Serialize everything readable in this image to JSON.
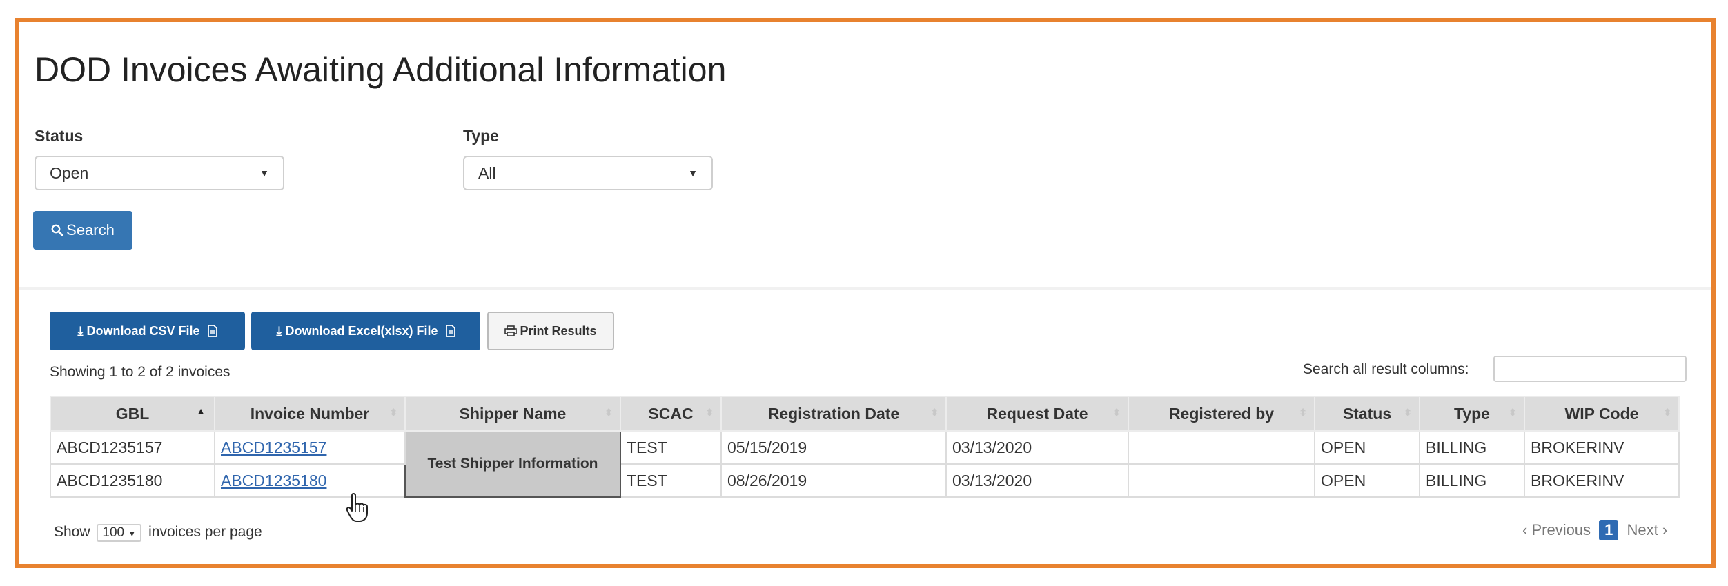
{
  "page": {
    "title": "DOD Invoices Awaiting Additional Information"
  },
  "filters": {
    "status_label": "Status",
    "status_value": "Open",
    "type_label": "Type",
    "type_value": "All",
    "caret": "▼"
  },
  "search_button": {
    "icon": "search-icon",
    "label": "Search"
  },
  "toolbar": {
    "csv_label": "Download CSV File",
    "excel_label": "Download Excel(xlsx) File",
    "print_label": "Print Results"
  },
  "results": {
    "showing": "Showing 1 to 2 of 2 invoices",
    "search_all_label": "Search all result columns:",
    "search_all_value": ""
  },
  "table": {
    "columns": [
      "GBL",
      "Invoice Number",
      "Shipper Name",
      "SCAC",
      "Registration Date",
      "Request Date",
      "Registered by",
      "Status",
      "Type",
      "WIP Code"
    ],
    "rows": [
      {
        "gbl": "ABCD1235157",
        "invoice": "ABCD1235157",
        "shipper": "Test Shipper Information",
        "scac": "TEST",
        "reg_date": "05/15/2019",
        "req_date": "03/13/2020",
        "registered_by": "",
        "status": "OPEN",
        "type": "BILLING",
        "wip": "BROKERINV"
      },
      {
        "gbl": "ABCD1235180",
        "invoice": "ABCD1235180",
        "shipper": "Test Shipper Information",
        "scac": "TEST",
        "reg_date": "08/26/2019",
        "req_date": "03/13/2020",
        "registered_by": "",
        "status": "OPEN",
        "type": "BILLING",
        "wip": "BROKERINV"
      }
    ]
  },
  "footer": {
    "show_label": "Show",
    "per_page_value": "100",
    "per_page_suffix": "invoices per page",
    "prev_label": "Previous",
    "current_page": "1",
    "next_label": "Next"
  },
  "colors": {
    "frame": "#e8822f",
    "primary": "#3676b3",
    "link": "#2f65ad"
  }
}
